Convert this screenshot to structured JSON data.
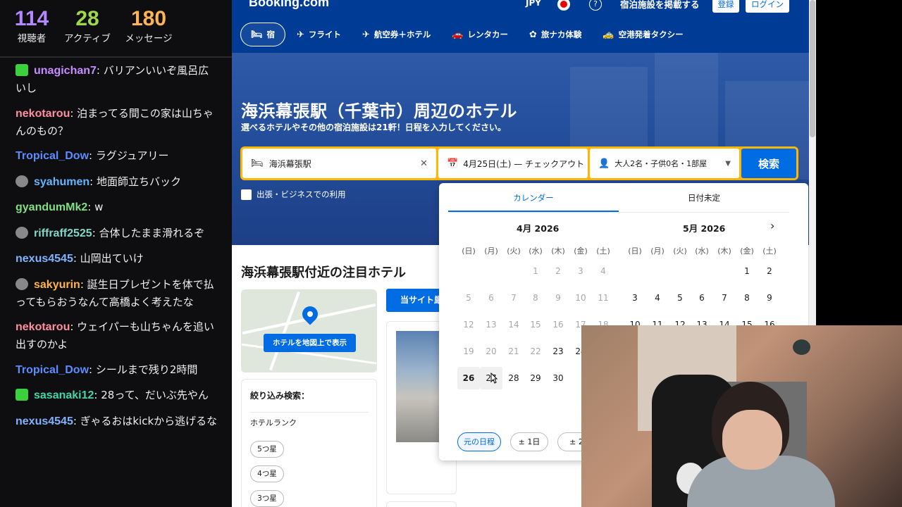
{
  "stats": [
    {
      "value": "114",
      "label": "視聴者",
      "color": "#b388ff"
    },
    {
      "value": "28",
      "label": "アクティブ",
      "color": "#9fd64a"
    },
    {
      "value": "180",
      "label": "メッセージ",
      "color": "#ffb454"
    }
  ],
  "chat": [
    {
      "user": "unagichan7",
      "text": "バリアンいいぞ風呂広いし",
      "color": "#c68dff",
      "badge": "green"
    },
    {
      "user": "nekotarou",
      "text": "泊まってる間この家は山ちゃんのもの？",
      "color": "#ff8fa0",
      "badge": ""
    },
    {
      "user": "Tropical_Dow",
      "text": "ラグジュアリー",
      "color": "#5c8dff",
      "badge": ""
    },
    {
      "user": "syahumen",
      "text": "地面師立ちバック",
      "color": "#5fb8ff",
      "badge": "char"
    },
    {
      "user": "gyandumMk2",
      "text": "w",
      "color": "#7fe07f",
      "badge": ""
    },
    {
      "user": "riffraff2525",
      "text": "合体したまま滑れるぞ",
      "color": "#7fd7c4",
      "badge": "char"
    },
    {
      "user": "nexus4545",
      "text": "山岡出ていけ",
      "color": "#7fb3ff",
      "badge": ""
    },
    {
      "user": "sakyurin",
      "text": "誕生日プレゼントを体で払ってもらおうなんて高橋よく考えたな",
      "color": "#ffb347",
      "badge": "char"
    },
    {
      "user": "nekotarou",
      "text": "ウェイパーも山ちゃんを追い出すのかよ",
      "color": "#ff8fa0",
      "badge": ""
    },
    {
      "user": "Tropical_Dow",
      "text": "シールまで残り2時間",
      "color": "#5c8dff",
      "badge": ""
    },
    {
      "user": "sasanaki12",
      "text": "28って、だいぶ先やん",
      "color": "#3fd6a8",
      "badge": "green"
    },
    {
      "user": "nexus4545",
      "text": "ぎゃるおはkickから逃げるな",
      "color": "#7fb3ff",
      "badge": ""
    }
  ],
  "site": {
    "logo": "Booking.com",
    "currency": "JPY",
    "list_property": "宿泊施設を掲載する",
    "register": "登録",
    "login": "ログイン",
    "nav": [
      {
        "label": "宿",
        "icon": "🛏"
      },
      {
        "label": "フライト",
        "icon": "✈"
      },
      {
        "label": "航空券＋ホテル",
        "icon": "✈"
      },
      {
        "label": "レンタカー",
        "icon": "🚗"
      },
      {
        "label": "旅ナカ体験",
        "icon": "✿"
      },
      {
        "label": "空港発着タクシー",
        "icon": "🚕"
      }
    ],
    "hero_title": "海浜幕張駅（千葉市）周辺のホテル",
    "hero_sub": "選べるホテルやその他の宿泊施設は21軒！日程を入力してください。",
    "destination": "海浜幕張駅",
    "dates": "4月25日(土) — チェックアウト",
    "guests": "大人2名・子供0名・1部屋",
    "search": "検索",
    "business": "出張・ビジネスでの利用",
    "section_title": "海浜幕張駅付近の注目ホテル",
    "map_button": "ホテルを地図上で表示",
    "filter_title": "絞り込み検索：",
    "rank_label": "ホテルランク",
    "ranks": [
      "5つ星",
      "4つ星",
      "3つ星"
    ],
    "site_tab": "当サイト厳"
  },
  "calendar": {
    "tabs": [
      "カレンダー",
      "日付未定"
    ],
    "months": [
      {
        "title": "4月 2026",
        "weeks": [
          [
            "",
            "",
            "",
            "1",
            "2",
            "3",
            "4"
          ],
          [
            "5",
            "6",
            "7",
            "8",
            "9",
            "10",
            "11"
          ],
          [
            "12",
            "13",
            "14",
            "15",
            "16",
            "17",
            "18"
          ],
          [
            "19",
            "20",
            "21",
            "22",
            "23",
            "24",
            ""
          ],
          [
            "26",
            "27",
            "28",
            "29",
            "30",
            "",
            ""
          ]
        ],
        "past_until": 22
      },
      {
        "title": "5月 2026",
        "weeks": [
          [
            "",
            "",
            "",
            "",
            "",
            "1",
            "2"
          ],
          [
            "3",
            "4",
            "5",
            "6",
            "7",
            "8",
            "9"
          ],
          [
            "10",
            "11",
            "12",
            "13",
            "14",
            "15",
            "16"
          ]
        ],
        "past_until": 0
      }
    ],
    "dow": [
      "(日)",
      "(月)",
      "(火)",
      "(水)",
      "(木)",
      "(金)",
      "(土)"
    ],
    "flex": [
      "元の日程",
      "± 1日",
      "± 2"
    ]
  }
}
